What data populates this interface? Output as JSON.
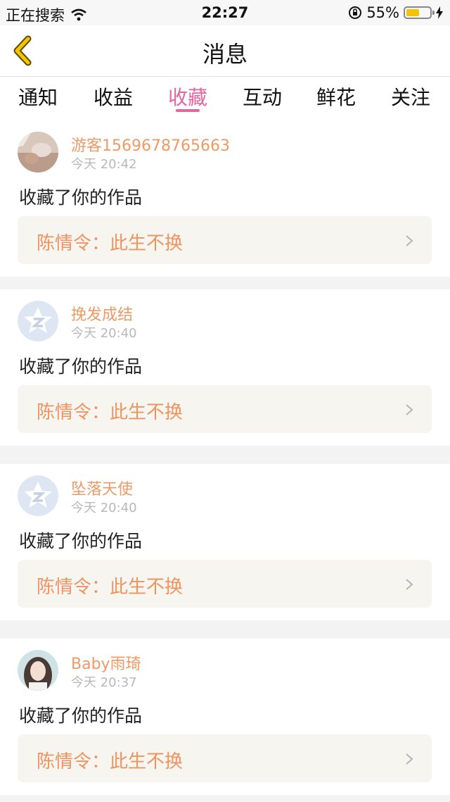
{
  "status_bar": {
    "carrier": "正在搜索",
    "time": "22:27",
    "battery_pct": "55%",
    "battery_level": 0.55,
    "icons": [
      "wifi-icon",
      "orientation-lock-icon",
      "battery-icon",
      "charging-icon"
    ]
  },
  "nav": {
    "title": "消息",
    "back_icon": "chevron-left-icon",
    "accent": "#f5c400"
  },
  "tabs": [
    {
      "label": "通知"
    },
    {
      "label": "收益"
    },
    {
      "label": "收藏"
    },
    {
      "label": "互动"
    },
    {
      "label": "鲜花"
    },
    {
      "label": "关注"
    }
  ],
  "active_tab_color": "#e8649e",
  "messages": [
    {
      "username": "游客1569678765663",
      "time": "今天 20:42",
      "action": "收藏了你的作品",
      "work": "陈情令：此生不换",
      "avatar": "photo-avatar"
    },
    {
      "username": "挽发成结",
      "time": "今天 20:40",
      "action": "收藏了你的作品",
      "work": "陈情令：此生不换",
      "avatar": "qq-default-avatar"
    },
    {
      "username": "坠落天使",
      "time": "今天 20:40",
      "action": "收藏了你的作品",
      "work": "陈情令：此生不换",
      "avatar": "qq-default-avatar"
    },
    {
      "username": "Baby雨琦",
      "time": "今天 20:37",
      "action": "收藏了你的作品",
      "work": "陈情令：此生不换",
      "avatar": "photo-avatar"
    }
  ]
}
